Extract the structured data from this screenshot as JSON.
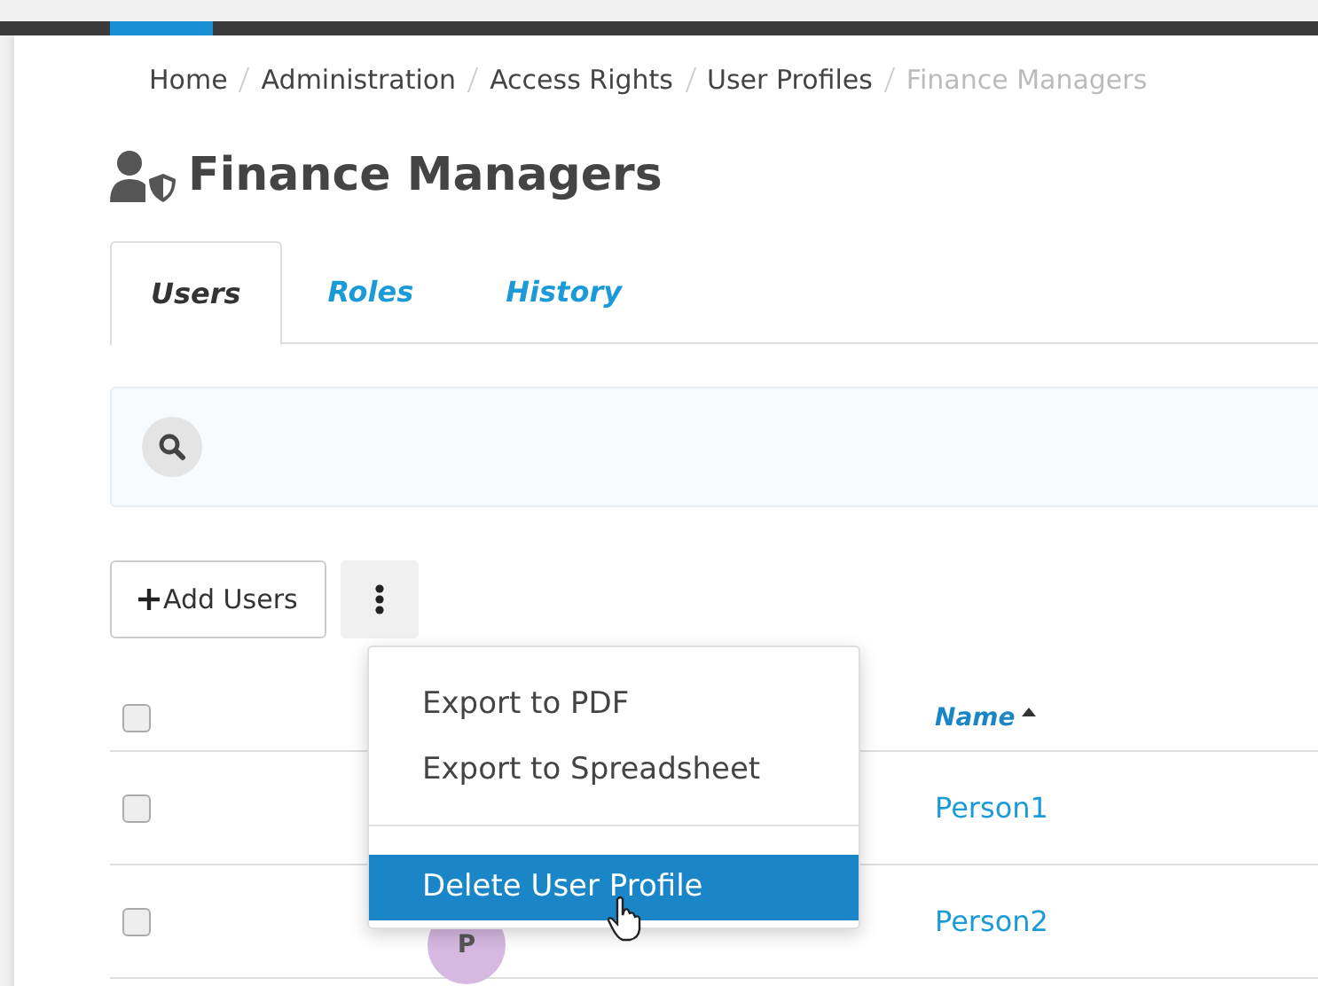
{
  "breadcrumb": [
    {
      "label": "Home",
      "current": false
    },
    {
      "label": "Administration",
      "current": false
    },
    {
      "label": "Access Rights",
      "current": false
    },
    {
      "label": "User Profiles",
      "current": false
    },
    {
      "label": "Finance Managers",
      "current": true
    }
  ],
  "title": "Finance Managers",
  "tabs": [
    {
      "label": "Users",
      "selected": true
    },
    {
      "label": "Roles",
      "selected": false
    },
    {
      "label": "History",
      "selected": false
    }
  ],
  "add_button": "Add Users",
  "menu": [
    {
      "label": "Export to PDF",
      "selected": false
    },
    {
      "label": "Export to Spreadsheet",
      "selected": false
    },
    {
      "label": "Delete User Profile",
      "selected": true
    }
  ],
  "table": {
    "select_all": false,
    "name_column": "Name",
    "sorted_ascending": true,
    "rows": [
      {
        "checked": false,
        "name": "Person1"
      },
      {
        "checked": false,
        "avatar": "P",
        "color": "#d6b8e0",
        "name": "Person2"
      }
    ]
  }
}
